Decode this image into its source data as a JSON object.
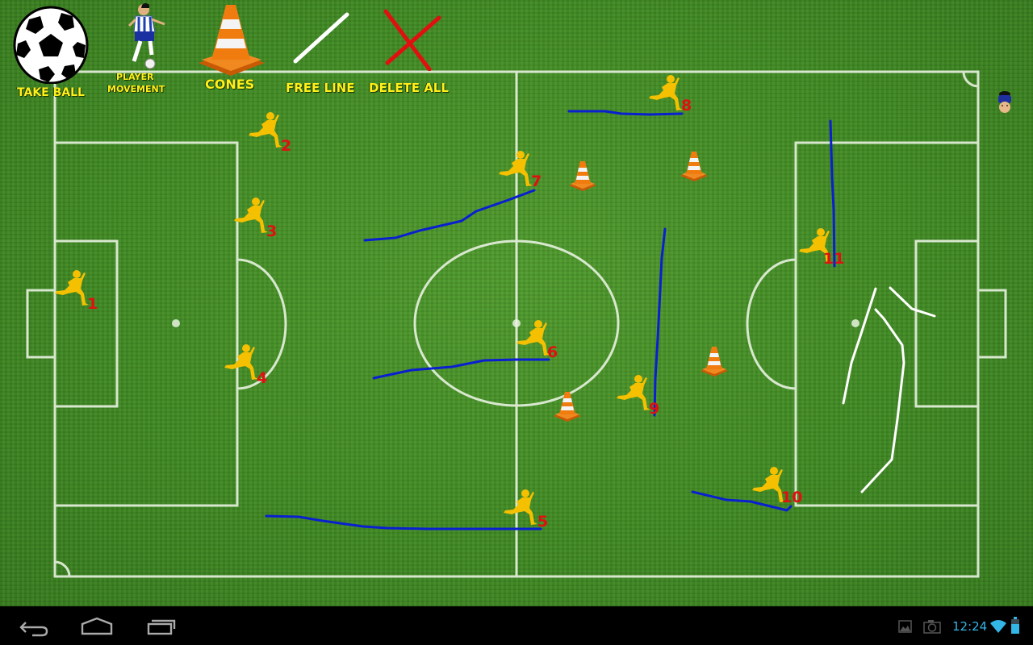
{
  "app": {
    "toolbar": {
      "take_ball": {
        "label": "TAKE BALL",
        "icon": "soccer-ball-icon"
      },
      "player_movement": {
        "label_line1": "PLAYER",
        "label_line2": "MOVEMENT",
        "icon": "player-figure-icon"
      },
      "cones": {
        "label": "CONES",
        "icon": "traffic-cone-icon"
      },
      "free_line": {
        "label": "FREE LINE",
        "icon": "white-line-icon"
      },
      "delete_all": {
        "label": "DELETE ALL",
        "icon": "red-x-icon"
      }
    },
    "players": [
      {
        "number": "1"
      },
      {
        "number": "2"
      },
      {
        "number": "3"
      },
      {
        "number": "4"
      },
      {
        "number": "5"
      },
      {
        "number": "6"
      },
      {
        "number": "7"
      },
      {
        "number": "8"
      },
      {
        "number": "9"
      },
      {
        "number": "10"
      },
      {
        "number": "11"
      }
    ],
    "player_color": "#f5c000",
    "number_color": "#e01010",
    "movement_line_color": "#0a1fcf",
    "free_line_color": "#ffffff",
    "cones_count": 5,
    "opponent_marker": {
      "icon": "opponent-player-token-icon"
    }
  },
  "system_bar": {
    "nav": {
      "back": "back-icon",
      "home": "home-icon",
      "recents": "recent-apps-icon"
    },
    "status": {
      "time": "12:24",
      "icons": [
        "gallery-icon",
        "camera-icon",
        "wifi-icon",
        "battery-icon"
      ]
    },
    "accent": "#33b5e5"
  }
}
